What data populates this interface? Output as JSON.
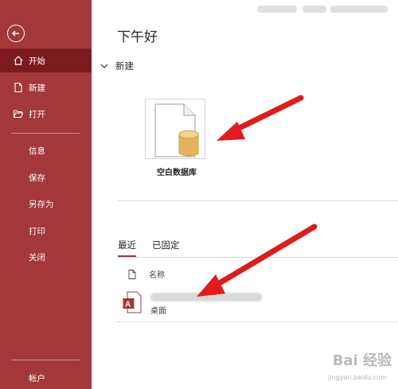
{
  "sidebar": {
    "items": [
      {
        "label": "开始"
      },
      {
        "label": "新建"
      },
      {
        "label": "打开"
      },
      {
        "label": "信息"
      },
      {
        "label": "保存"
      },
      {
        "label": "另存为"
      },
      {
        "label": "打印"
      },
      {
        "label": "关闭"
      }
    ],
    "account_label": "帐户"
  },
  "main": {
    "greeting": "下午好",
    "new_section_label": "新建",
    "template_label": "空白数据库",
    "tabs": [
      {
        "label": "最近",
        "active": true
      },
      {
        "label": "已固定",
        "active": false
      }
    ],
    "list_header_name": "名称",
    "recent_files": [
      {
        "path": "桌面",
        "icon": "access-file-icon"
      }
    ]
  },
  "watermark": {
    "brand": "Bai 经验",
    "url": "jingyan.baidu.com"
  },
  "colors": {
    "sidebar": "#a4373a",
    "sidebar_selected": "#7b1b1d",
    "annotation_arrow": "#e21a1a",
    "access_icon": "#a4373a",
    "database_cylinder": "#e3b45c"
  }
}
